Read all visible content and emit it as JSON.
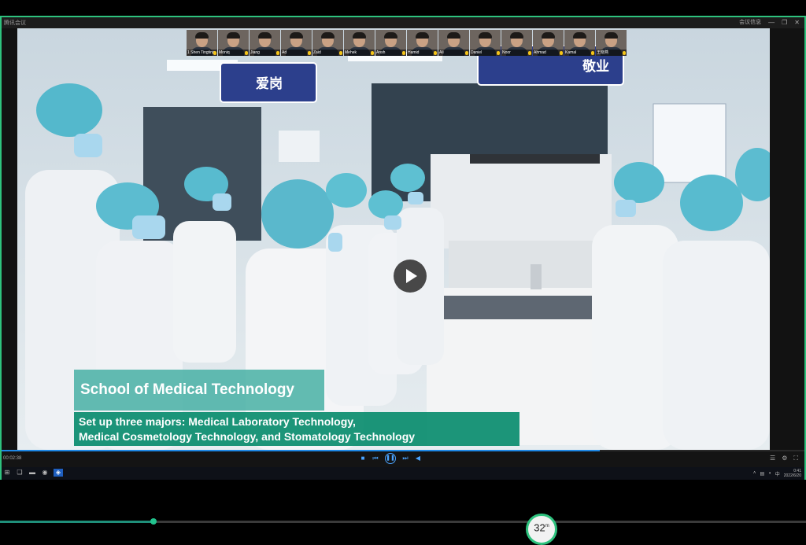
{
  "window": {
    "app_title": "腾讯会议",
    "meeting_label": "会议信息",
    "controls": [
      "—",
      "❐",
      "✕"
    ]
  },
  "participants": [
    {
      "name": "1 Shen Tingting"
    },
    {
      "name": "Moniq"
    },
    {
      "name": "Jiang"
    },
    {
      "name": "Ad"
    },
    {
      "name": "Zaid"
    },
    {
      "name": "Mehek"
    },
    {
      "name": "Ansh"
    },
    {
      "name": "Hamid"
    },
    {
      "name": "Ali"
    },
    {
      "name": "Daniel"
    },
    {
      "name": "Noor"
    },
    {
      "name": "Ahmad"
    },
    {
      "name": "Kamal"
    },
    {
      "name": "王晓燕"
    }
  ],
  "video": {
    "caption_title": "School of Medical Technology",
    "caption_lines": [
      "Set up three majors: Medical Laboratory Technology,",
      "Medical Cosmetology Technology, and Stomatology Technology"
    ],
    "sign_left": "爱岗",
    "sign_right": "敬业"
  },
  "player": {
    "time": "00:02:38",
    "progress_fraction": 0.745
  },
  "taskbar": {
    "time": "0:41",
    "date": "2022/6/20"
  },
  "outer_player": {
    "timer_value": "32",
    "timer_unit": "m",
    "progress_fraction": 0.19
  }
}
